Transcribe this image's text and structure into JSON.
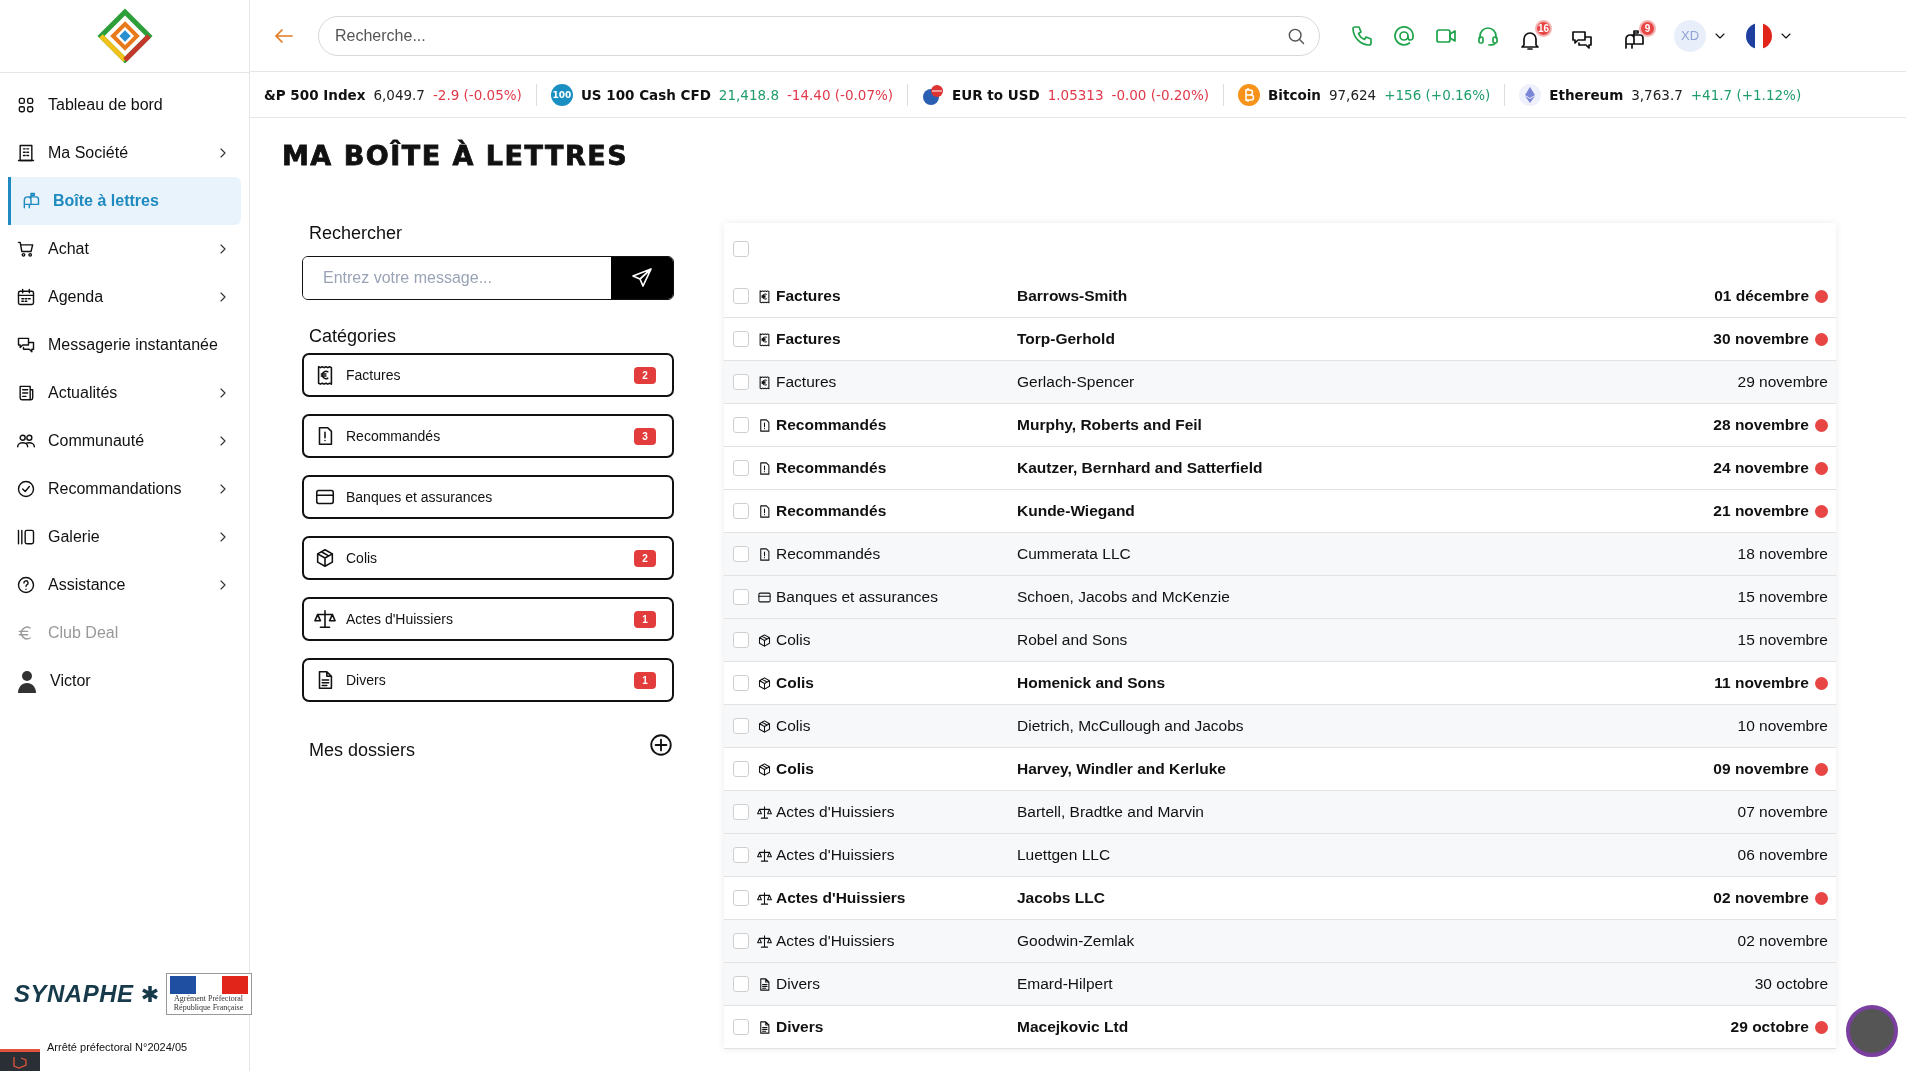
{
  "sidebar": {
    "items": [
      {
        "label": "Tableau de bord",
        "has_submenu": false,
        "selected": false,
        "disabled": false
      },
      {
        "label": "Ma Société",
        "has_submenu": true,
        "selected": false,
        "disabled": false
      },
      {
        "label": "Boîte à lettres",
        "has_submenu": false,
        "selected": true,
        "disabled": false
      },
      {
        "label": "Achat",
        "has_submenu": true,
        "selected": false,
        "disabled": false
      },
      {
        "label": "Agenda",
        "has_submenu": true,
        "selected": false,
        "disabled": false
      },
      {
        "label": "Messagerie instantanée",
        "has_submenu": false,
        "selected": false,
        "disabled": false
      },
      {
        "label": "Actualités",
        "has_submenu": true,
        "selected": false,
        "disabled": false
      },
      {
        "label": "Communauté",
        "has_submenu": true,
        "selected": false,
        "disabled": false
      },
      {
        "label": "Recommandations",
        "has_submenu": true,
        "selected": false,
        "disabled": false
      },
      {
        "label": "Galerie",
        "has_submenu": true,
        "selected": false,
        "disabled": false
      },
      {
        "label": "Assistance",
        "has_submenu": true,
        "selected": false,
        "disabled": false
      },
      {
        "label": "Club Deal",
        "has_submenu": false,
        "selected": false,
        "disabled": true
      },
      {
        "label": "Victor",
        "has_submenu": false,
        "selected": false,
        "disabled": false
      }
    ],
    "footer": {
      "brand": "SYNAPHE",
      "badge_line_1": "Agrément Préfectoral",
      "badge_line_2": "République Française",
      "decree": "Arrêté préfectoral N°2024/05"
    }
  },
  "topbar": {
    "search": {
      "placeholder": "Recherche..."
    },
    "notifications_count": "16",
    "mail_count": "9",
    "user_initials": "XD"
  },
  "ticker": [
    {
      "name": "&P 500 Index",
      "price": "6,049.7",
      "change": "-2.9 (-0.05%)",
      "gain": false,
      "price_up": false,
      "price_down": false
    },
    {
      "name": "US 100 Cash CFD",
      "price": "21,418.8",
      "change": "-14.40 (-0.07%)",
      "gain": false,
      "price_up": true,
      "price_down": false,
      "logo": "100"
    },
    {
      "name": "EUR to USD",
      "price": "1.05313",
      "change": "-0.00 (-0.20%)",
      "gain": false,
      "price_up": false,
      "price_down": true
    },
    {
      "name": "Bitcoin",
      "price": "97,624",
      "change": "+156 (+0.16%)",
      "gain": true,
      "price_up": false,
      "price_down": false
    },
    {
      "name": "Ethereum",
      "price": "3,763.7",
      "change": "+41.7 (+1.12%)",
      "gain": true,
      "price_up": false,
      "price_down": false
    }
  ],
  "page_title": "MA BOÎTE À LETTRES",
  "filters": {
    "search_label": "Rechercher",
    "search": {
      "placeholder": "Entrez votre message..."
    },
    "categories_label": "Catégories",
    "categories": [
      {
        "kind": "invoice",
        "label": "Factures",
        "count": "2"
      },
      {
        "kind": "registered",
        "label": "Recommandés",
        "count": "3"
      },
      {
        "kind": "bank",
        "label": "Banques et assurances"
      },
      {
        "kind": "parcel",
        "label": "Colis",
        "count": "2"
      },
      {
        "kind": "bailiff",
        "label": "Actes d'Huissiers",
        "count": "1"
      },
      {
        "kind": "misc",
        "label": "Divers",
        "count": "1"
      }
    ],
    "folders_label": "Mes dossiers"
  },
  "messages": {
    "select_all_checked": false,
    "rows": [
      {
        "kind": "invoice",
        "category": "Factures",
        "sender": "Barrows-Smith",
        "date": "01 décembre",
        "unread": true,
        "checked": false
      },
      {
        "kind": "invoice",
        "category": "Factures",
        "sender": "Torp-Gerhold",
        "date": "30 novembre",
        "unread": true,
        "checked": false
      },
      {
        "kind": "invoice",
        "category": "Factures",
        "sender": "Gerlach-Spencer",
        "date": "29 novembre",
        "unread": false,
        "checked": false
      },
      {
        "kind": "registered",
        "category": "Recommandés",
        "sender": "Murphy, Roberts and Feil",
        "date": "28 novembre",
        "unread": true,
        "checked": false
      },
      {
        "kind": "registered",
        "category": "Recommandés",
        "sender": "Kautzer, Bernhard and Satterfield",
        "date": "24 novembre",
        "unread": true,
        "checked": false
      },
      {
        "kind": "registered",
        "category": "Recommandés",
        "sender": "Kunde-Wiegand",
        "date": "21 novembre",
        "unread": true,
        "checked": false
      },
      {
        "kind": "registered",
        "category": "Recommandés",
        "sender": "Cummerata LLC",
        "date": "18 novembre",
        "unread": false,
        "checked": false
      },
      {
        "kind": "bank",
        "category": "Banques et assurances",
        "sender": "Schoen, Jacobs and McKenzie",
        "date": "15 novembre",
        "unread": false,
        "checked": false
      },
      {
        "kind": "parcel",
        "category": "Colis",
        "sender": "Robel and Sons",
        "date": "15 novembre",
        "unread": false,
        "checked": false
      },
      {
        "kind": "parcel",
        "category": "Colis",
        "sender": "Homenick and Sons",
        "date": "11 novembre",
        "unread": true,
        "checked": false
      },
      {
        "kind": "parcel",
        "category": "Colis",
        "sender": "Dietrich, McCullough and Jacobs",
        "date": "10 novembre",
        "unread": false,
        "checked": false
      },
      {
        "kind": "parcel",
        "category": "Colis",
        "sender": "Harvey, Windler and Kerluke",
        "date": "09 novembre",
        "unread": true,
        "checked": false
      },
      {
        "kind": "bailiff",
        "category": "Actes d'Huissiers",
        "sender": "Bartell, Bradtke and Marvin",
        "date": "07 novembre",
        "unread": false,
        "checked": false
      },
      {
        "kind": "bailiff",
        "category": "Actes d'Huissiers",
        "sender": "Luettgen LLC",
        "date": "06 novembre",
        "unread": false,
        "checked": false
      },
      {
        "kind": "bailiff",
        "category": "Actes d'Huissiers",
        "sender": "Jacobs LLC",
        "date": "02 novembre",
        "unread": true,
        "checked": false
      },
      {
        "kind": "bailiff",
        "category": "Actes d'Huissiers",
        "sender": "Goodwin-Zemlak",
        "date": "02 novembre",
        "unread": false,
        "checked": false
      },
      {
        "kind": "misc",
        "category": "Divers",
        "sender": "Emard-Hilpert",
        "date": "30 octobre",
        "unread": false,
        "checked": false
      },
      {
        "kind": "misc",
        "category": "Divers",
        "sender": "Macejkovic Ltd",
        "date": "29 octobre",
        "unread": true,
        "checked": false
      }
    ]
  }
}
